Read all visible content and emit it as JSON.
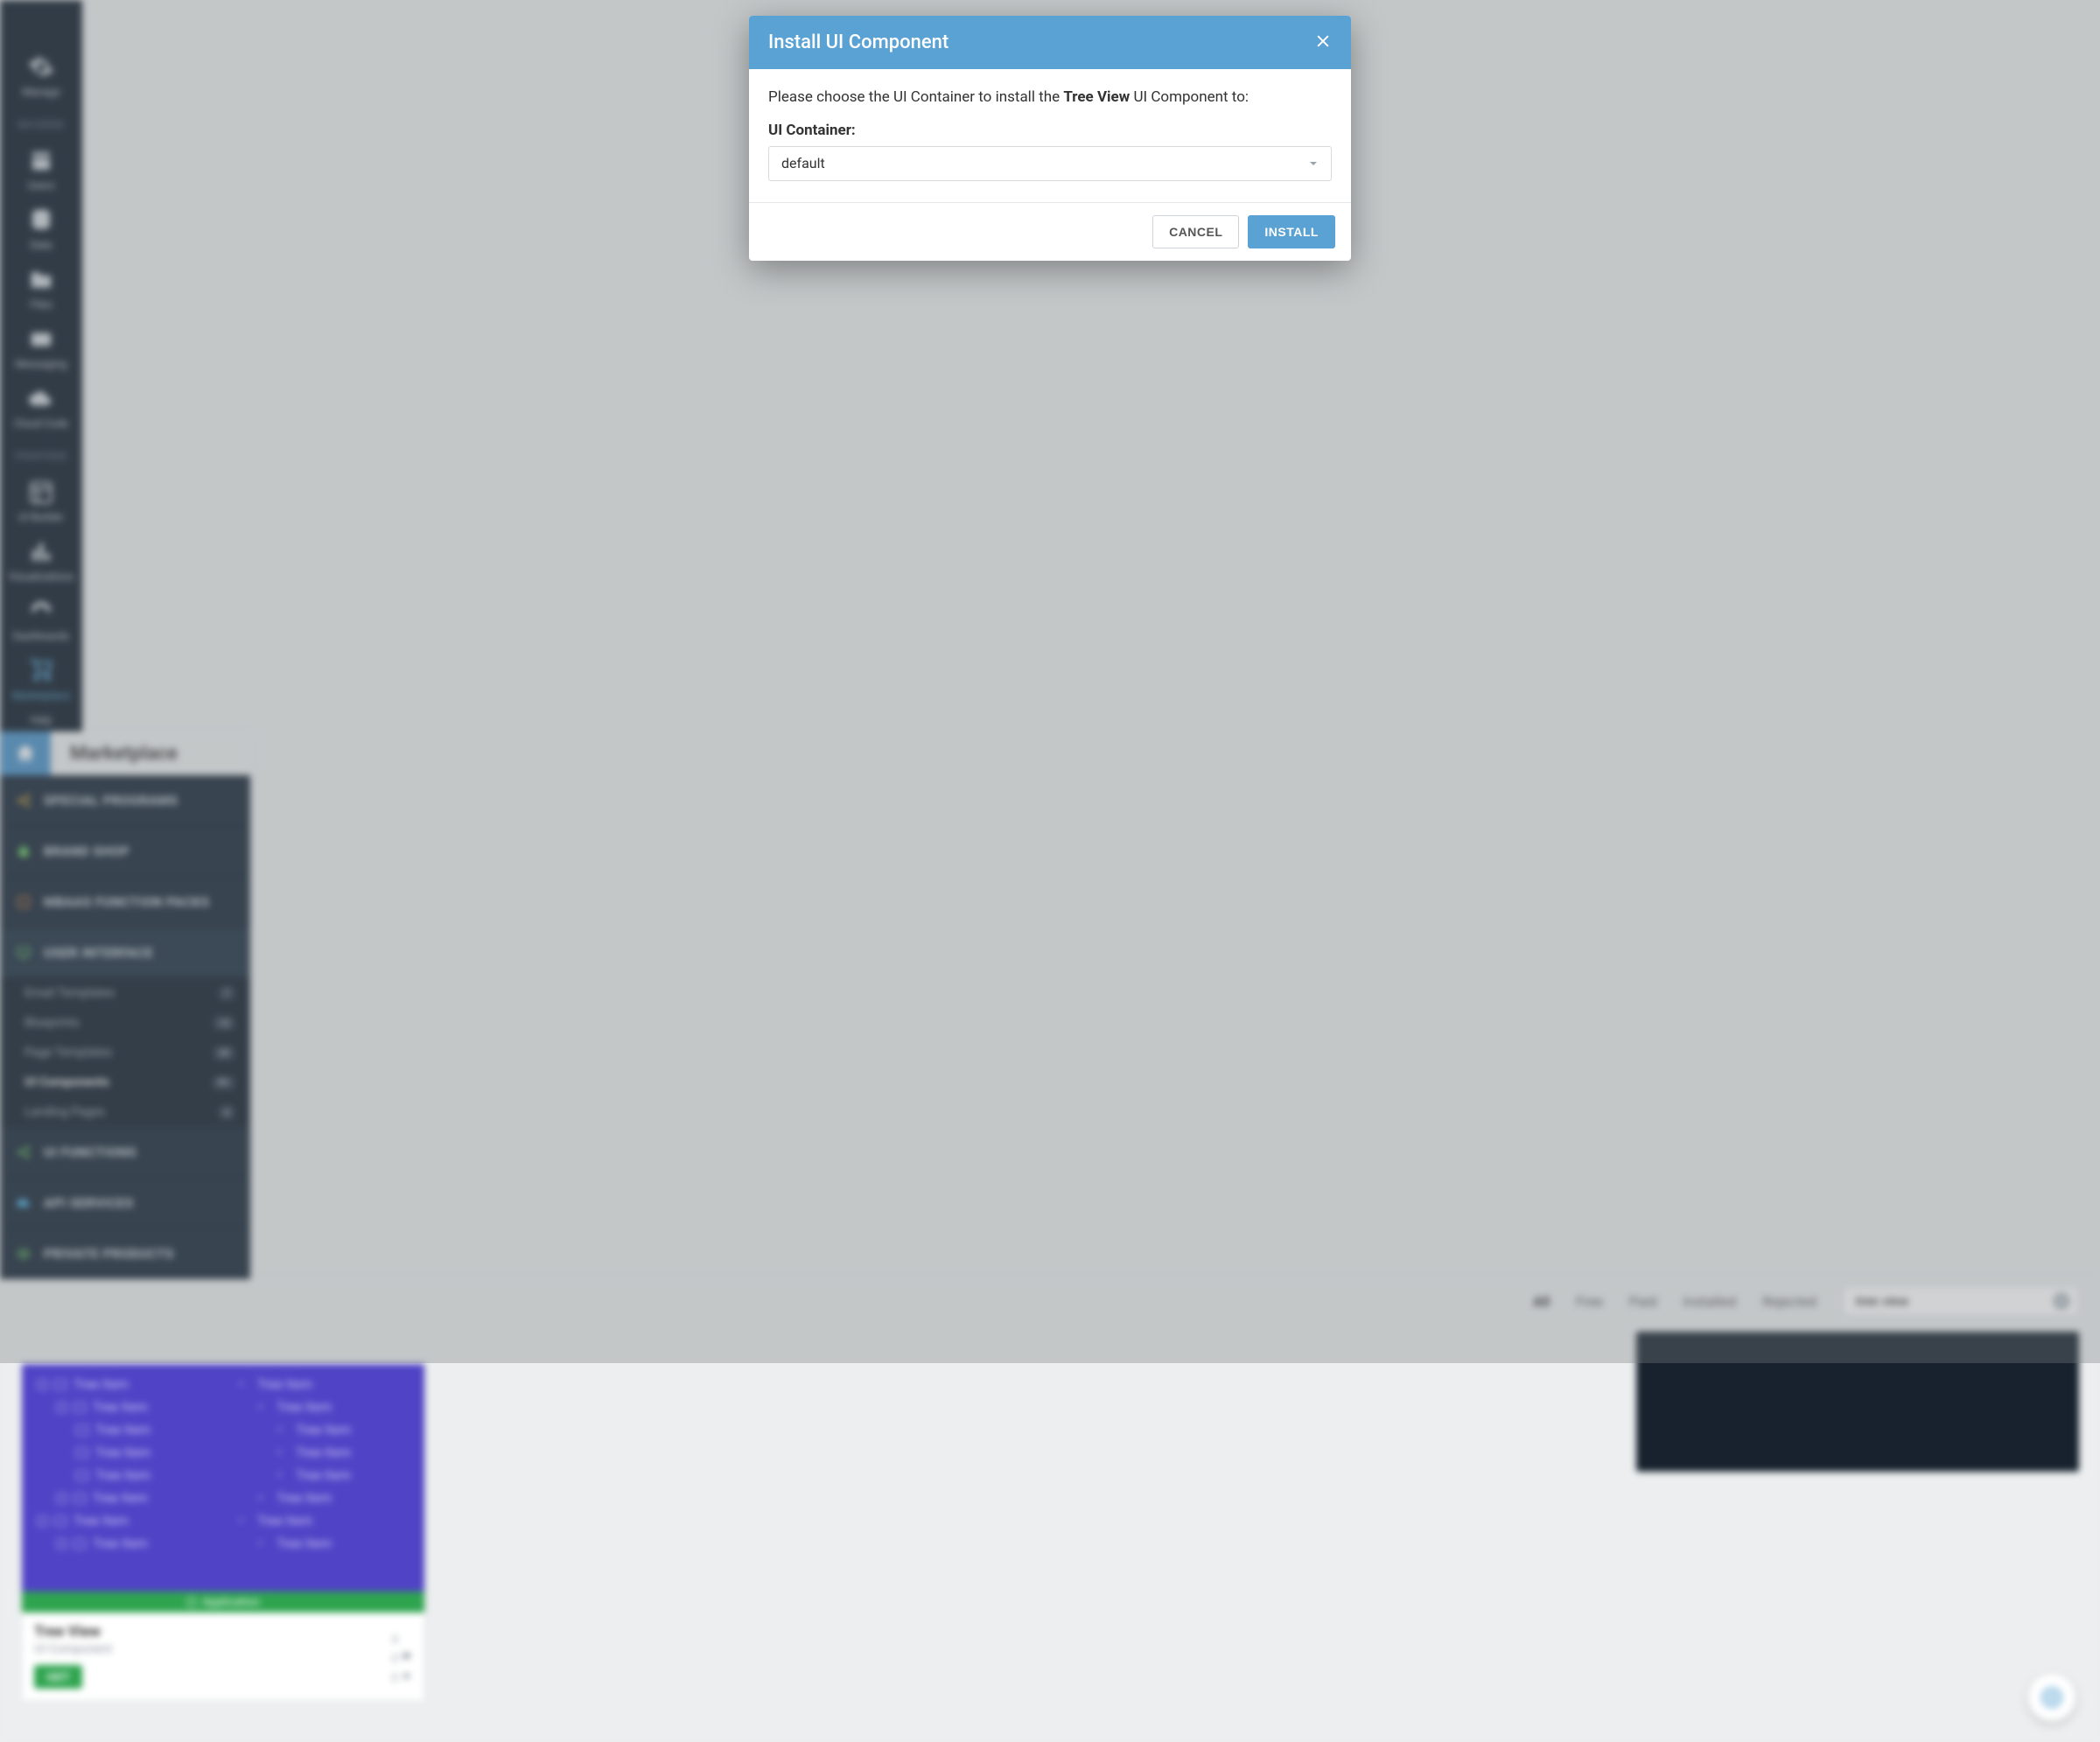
{
  "page": {
    "title": "Marketplace"
  },
  "rail": {
    "sections": [
      "",
      "BACKEND",
      "FRONTEND"
    ],
    "items": [
      {
        "label": "Manage",
        "icon": "gear-icon"
      },
      {
        "label": "Users",
        "icon": "users-icon"
      },
      {
        "label": "Data",
        "icon": "database-icon"
      },
      {
        "label": "Files",
        "icon": "folder-icon"
      },
      {
        "label": "Messaging",
        "icon": "mail-icon"
      },
      {
        "label": "Cloud Code",
        "icon": "cloud-icon"
      },
      {
        "label": "UI Builder",
        "icon": "layout-icon"
      },
      {
        "label": "Visualizations",
        "icon": "chart-icon"
      },
      {
        "label": "Dashboards",
        "icon": "gauge-icon"
      },
      {
        "label": "Marketplace",
        "icon": "cart-icon"
      },
      {
        "label": "Help",
        "icon": ""
      }
    ]
  },
  "sidenav": {
    "categories": [
      {
        "label": "SPECIAL PROGRAMS",
        "color": "#f1b73a"
      },
      {
        "label": "BRAND SHOP",
        "color": "#6ccf63"
      },
      {
        "label": "MBAAS FUNCTION PACKS",
        "color": "#f08a3c"
      },
      {
        "label": "USER INTERFACE",
        "color": "#6ccf63",
        "sub": [
          {
            "label": "Email Templates",
            "badge": "7"
          },
          {
            "label": "Blueprints",
            "badge": "18"
          },
          {
            "label": "Page Templates",
            "badge": "38"
          },
          {
            "label": "UI Components",
            "badge": "91",
            "active": true
          },
          {
            "label": "Landing Pages",
            "badge": "4"
          }
        ]
      },
      {
        "label": "UI FUNCTIONS",
        "color": "#6ccf63"
      },
      {
        "label": "API SERVICES",
        "color": "#4aa8d8"
      },
      {
        "label": "PRIVATE PRODUCTS",
        "color": "#6ccf63"
      }
    ]
  },
  "filters": {
    "items": [
      "All",
      "Free",
      "Paid",
      "Installed",
      "Rejected"
    ],
    "active": "All"
  },
  "search": {
    "value": "tree view"
  },
  "card": {
    "title": "Tree View",
    "subtitle": "UI Component",
    "button": "GET",
    "strip": "Application",
    "tree_label": "Tree Item",
    "stats": {
      "downloads": "4",
      "comments": "0",
      "stars": "0"
    }
  },
  "modal": {
    "title": "Install UI Component",
    "body_prefix": "Please choose the UI Container to install the ",
    "component_name": "Tree View",
    "body_suffix": " UI Component to:",
    "field_label": "UI Container:",
    "selected": "default",
    "cancel": "CANCEL",
    "confirm": "INSTALL"
  }
}
